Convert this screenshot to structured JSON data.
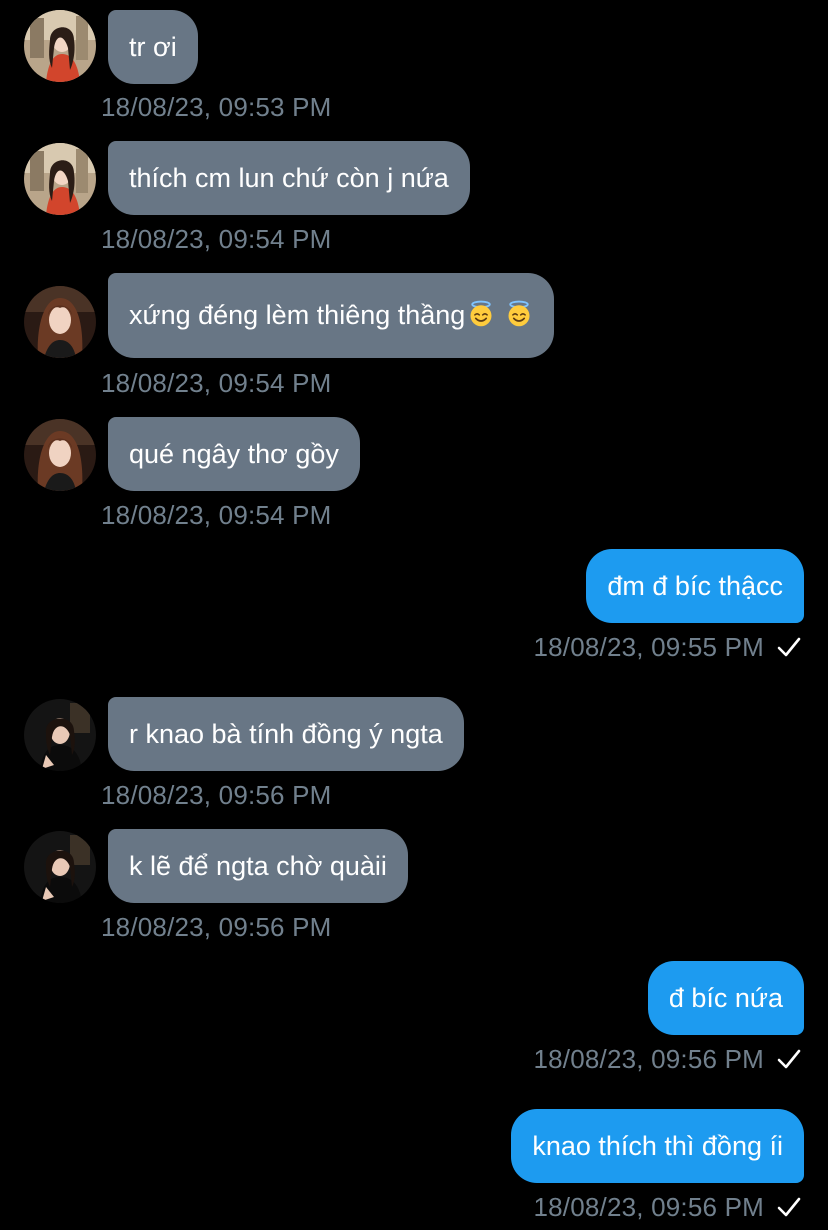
{
  "messages": [
    {
      "direction": "incoming",
      "avatar": "avatar-red-dress",
      "text": "tr ơi",
      "time": "18/08/23, 09:53 PM"
    },
    {
      "direction": "incoming",
      "avatar": "avatar-red-dress",
      "text": "thích cm lun chứ còn j nứa",
      "time": "18/08/23, 09:54 PM"
    },
    {
      "direction": "incoming",
      "avatar": "avatar-long-hair",
      "text": "xứng đéng lèm thiêng thầng",
      "emoji": [
        "smiling-face-with-halo-emoji",
        "smiling-face-with-halo-emoji"
      ],
      "time": "18/08/23, 09:54 PM"
    },
    {
      "direction": "incoming",
      "avatar": "avatar-long-hair",
      "text": "qué ngây thơ gồy",
      "time": "18/08/23, 09:54 PM"
    },
    {
      "direction": "outgoing",
      "text": "đm đ bíc thậcc",
      "time": "18/08/23, 09:55 PM",
      "status_icon": "checkmark-icon"
    },
    {
      "direction": "incoming",
      "avatar": "avatar-dark-outfit",
      "text": "r knao bà tính đồng ý ngta",
      "time": "18/08/23, 09:56 PM"
    },
    {
      "direction": "incoming",
      "avatar": "avatar-dark-outfit",
      "text": "k lẽ để ngta chờ quàii",
      "time": "18/08/23, 09:56 PM"
    },
    {
      "direction": "outgoing",
      "text": "đ bíc nứa",
      "time": "18/08/23, 09:56 PM",
      "status_icon": "checkmark-icon"
    },
    {
      "direction": "outgoing",
      "text": "knao thích thì đồng íi",
      "time": "18/08/23, 09:56 PM",
      "status_icon": "checkmark-icon"
    }
  ],
  "colors": {
    "background": "#000000",
    "incoming_bubble": "#687685",
    "outgoing_bubble": "#1d9bf0",
    "message_text": "#ffffff",
    "timestamp": "#71808d"
  }
}
